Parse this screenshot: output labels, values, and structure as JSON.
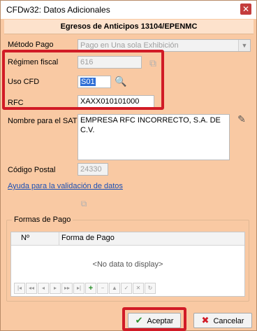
{
  "window": {
    "title": "CFDw32: Datos Adicionales",
    "close_glyph": "✕"
  },
  "header": {
    "text": "Egresos de Anticipos 13104/EPENMC"
  },
  "fields": {
    "metodo_pago": {
      "label": "Método Pago",
      "value": "Pago en Una sola Exhibición"
    },
    "regimen_fiscal": {
      "label": "Régimen fiscal",
      "value": "616"
    },
    "uso_cfd": {
      "label": "Uso CFD",
      "value": "S01"
    },
    "rfc": {
      "label": "RFC",
      "value": "XAXX010101000"
    },
    "nombre_sat": {
      "label": "Nombre para el SAT",
      "value": "EMPRESA RFC INCORRECTO, S.A. DE C.V."
    },
    "codigo_postal": {
      "label": "Código Postal",
      "value": "24330"
    }
  },
  "help_link": "Ayuda para la validación de datos",
  "formas_pago": {
    "group_title": "Formas de Pago",
    "columns": [
      "Nº",
      "Forma de Pago"
    ],
    "empty_text": "<No data to display>",
    "nav": [
      "|◂",
      "◂◂",
      "◂",
      "▸",
      "▸▸",
      "▸|",
      "+",
      "−",
      "▲",
      "✓",
      "✕",
      "↻"
    ]
  },
  "buttons": {
    "accept": "Aceptar",
    "cancel": "Cancelar"
  },
  "icons": {
    "search": "search-icon",
    "regimen_lookup": "lookup-icon",
    "edit_name": "edit-icon",
    "help": "help-icon"
  },
  "colors": {
    "background": "#f9c9a3",
    "highlight": "#d11b26",
    "link": "#1b4fb5",
    "accept_icon": "#2a8f2a",
    "cancel_icon": "#d11b26"
  }
}
